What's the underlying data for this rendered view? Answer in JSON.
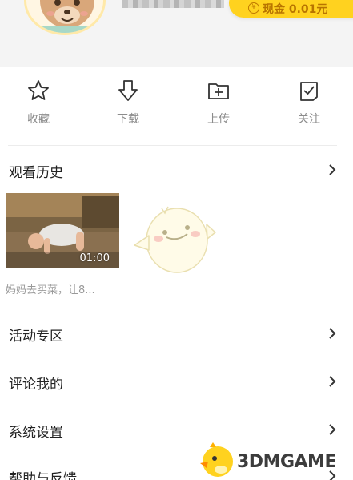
{
  "header": {
    "cash_label": "现金 0.01元",
    "cash_icon": "yen-coin-icon",
    "avatar_icon": "bear-avatar-icon"
  },
  "actions": [
    {
      "label": "收藏",
      "icon": "star-icon"
    },
    {
      "label": "下载",
      "icon": "download-arrow-icon"
    },
    {
      "label": "上传",
      "icon": "folder-plus-icon"
    },
    {
      "label": "关注",
      "icon": "checkbox-icon"
    }
  ],
  "history": {
    "section_label": "观看历史",
    "items": [
      {
        "title": "妈妈去买菜，让8...",
        "duration": "01:00"
      }
    ]
  },
  "menu": {
    "activity": "活动专区",
    "comments": "评论我的",
    "settings": "系统设置",
    "help": "帮助与反馈"
  },
  "watermark": {
    "text": "3DMGAME"
  },
  "colors": {
    "accent": "#ffd21f",
    "accent_text": "#b87400",
    "text_primary": "#222222",
    "text_muted": "#8c8c8c"
  }
}
